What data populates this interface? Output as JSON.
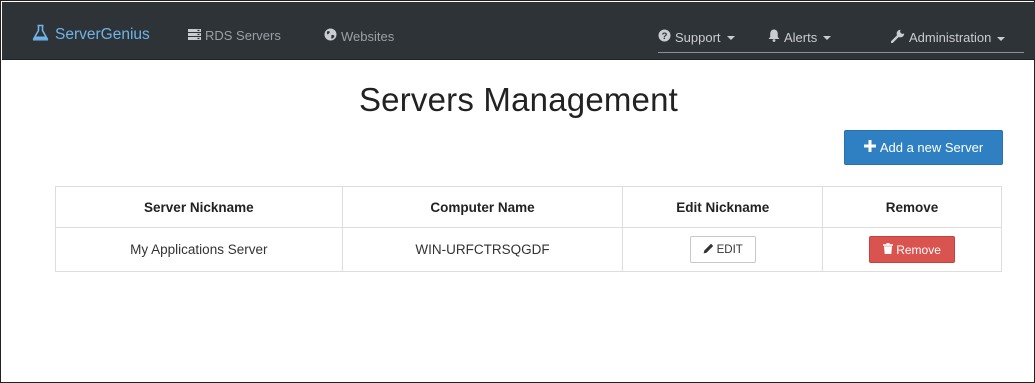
{
  "navbar": {
    "brand": "ServerGenius",
    "links": {
      "rds": "RDS Servers",
      "websites": "Websites"
    },
    "dropdowns": {
      "support": "Support",
      "alerts": "Alerts",
      "administration": "Administration"
    },
    "colors": {
      "background": "#2e3338",
      "brand": "#6fb3e8"
    }
  },
  "main": {
    "title": "Servers Management",
    "add_button": "Add a new Server"
  },
  "table": {
    "headers": [
      "Server Nickname",
      "Computer Name",
      "Edit Nickname",
      "Remove"
    ],
    "rows": [
      {
        "nickname": "My Applications Server",
        "computer": "WIN-URFCTRSQGDF",
        "edit": "EDIT",
        "remove": "Remove"
      }
    ]
  },
  "icons": {
    "brand": "flask-icon",
    "rds": "server-stack-icon",
    "websites": "globe-icon",
    "support": "question-circle-icon",
    "alerts": "bell-icon",
    "administration": "wrench-icon",
    "add": "plus-icon",
    "edit": "pencil-icon",
    "remove": "trash-icon"
  },
  "colors": {
    "primary": "#2f80c2",
    "danger": "#d9534f"
  }
}
